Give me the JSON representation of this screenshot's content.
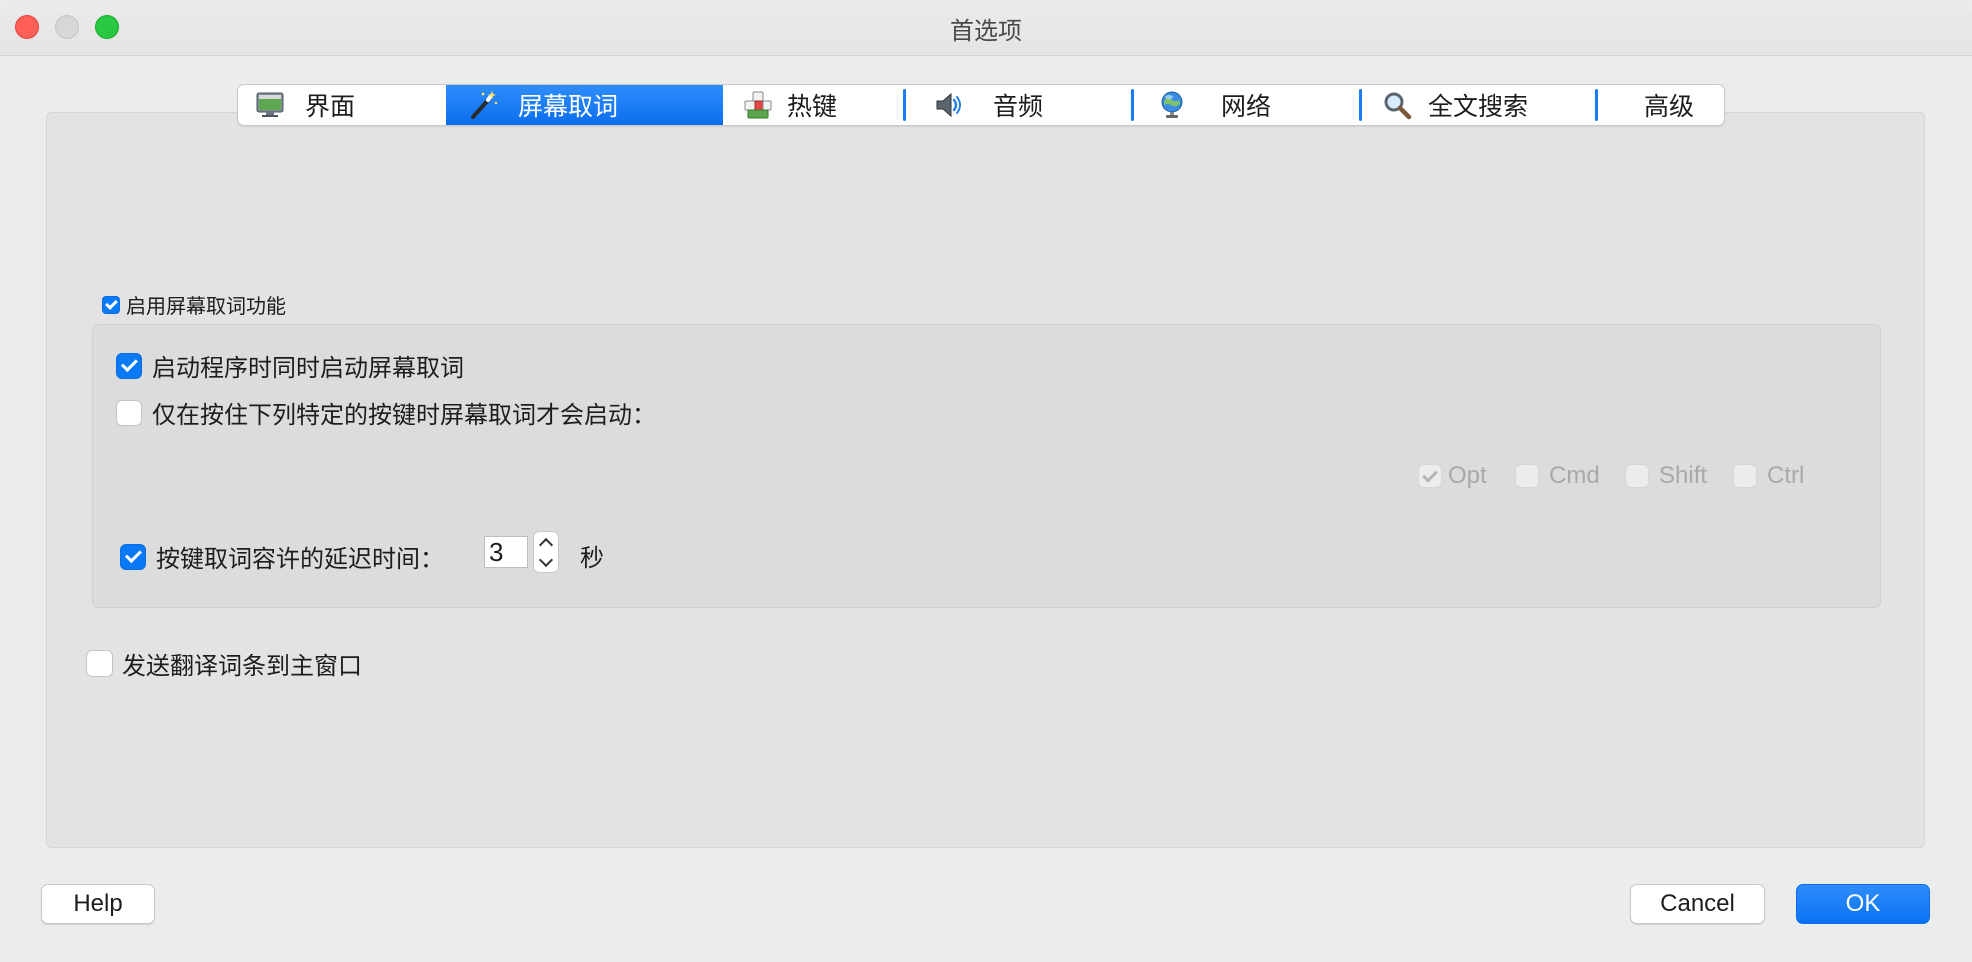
{
  "window": {
    "title": "首选项"
  },
  "tabs": [
    {
      "label": "界面",
      "icon": "monitor-icon",
      "selected": false
    },
    {
      "label": "屏幕取词",
      "icon": "magic-wand-icon",
      "selected": true
    },
    {
      "label": "热键",
      "icon": "keyboard-icon",
      "selected": false
    },
    {
      "label": "音频",
      "icon": "speaker-icon",
      "selected": false
    },
    {
      "label": "网络",
      "icon": "globe-network-icon",
      "selected": false
    },
    {
      "label": "全文搜索",
      "icon": "magnifier-icon",
      "selected": false
    },
    {
      "label": "高级",
      "icon": "",
      "selected": false
    }
  ],
  "screen_lookup": {
    "enable_label": "启用屏幕取词功能",
    "enable_checked": true,
    "start_with_app_label": "启动程序时同时启动屏幕取词",
    "start_with_app_checked": true,
    "only_with_keys_label": "仅在按住下列特定的按键时屏幕取词才会启动：",
    "only_with_keys_checked": false,
    "modifier_keys": [
      {
        "label": "Opt",
        "checked": true
      },
      {
        "label": "Cmd",
        "checked": false
      },
      {
        "label": "Shift",
        "checked": false
      },
      {
        "label": "Ctrl",
        "checked": false
      }
    ],
    "delay_label": "按键取词容许的延迟时间：",
    "delay_checked": true,
    "delay_value": "3",
    "delay_unit": "秒",
    "send_to_main_label": "发送翻译词条到主窗口",
    "send_to_main_checked": false
  },
  "buttons": {
    "help": "Help",
    "cancel": "Cancel",
    "ok": "OK"
  },
  "colors": {
    "accent": "#0a79f5",
    "window_bg": "#ececec",
    "panel_bg": "#e3e3e3"
  }
}
